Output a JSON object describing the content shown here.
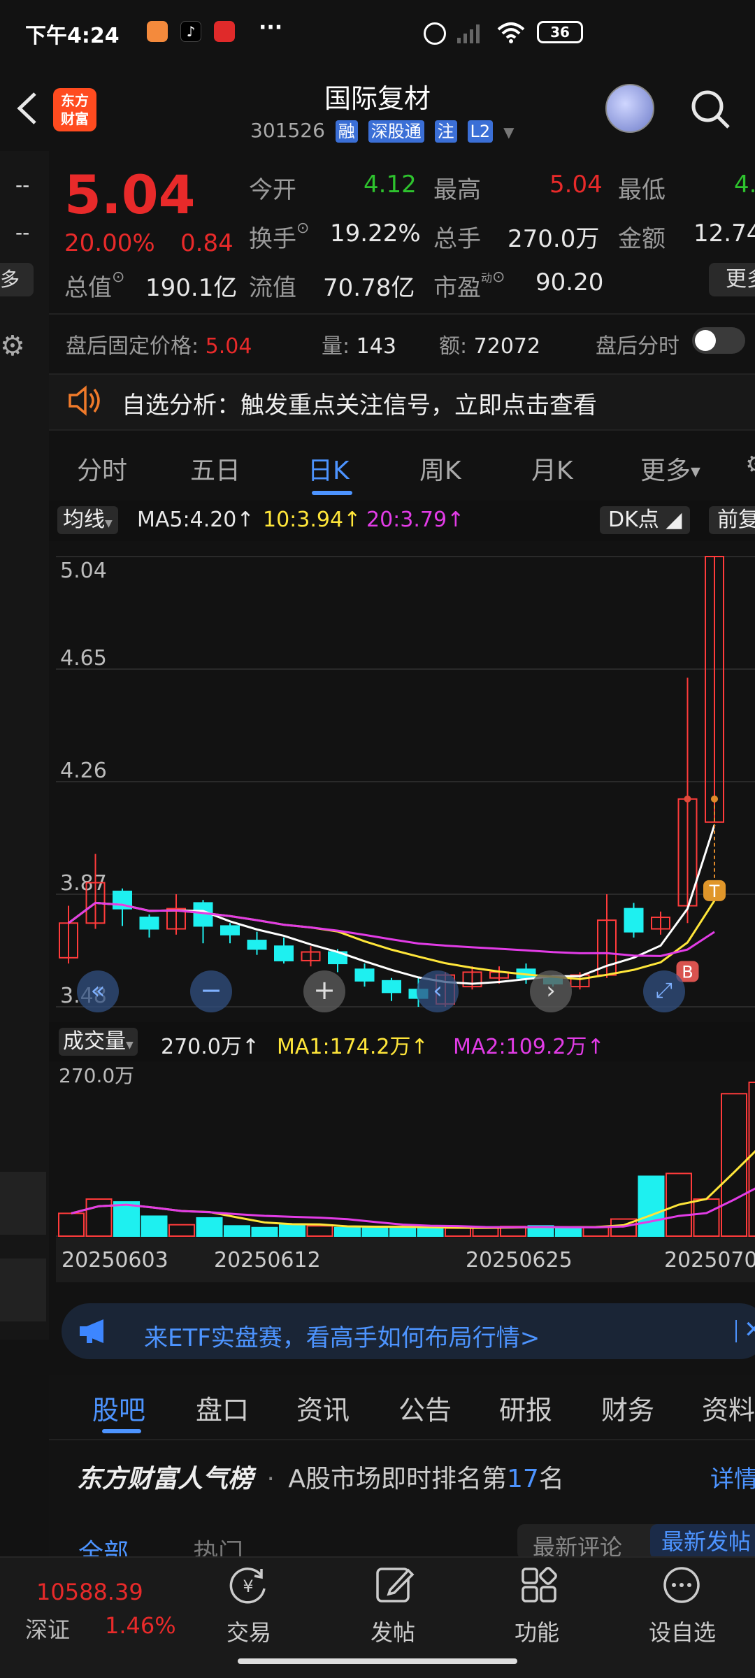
{
  "status_bar": {
    "time": "下午4:24",
    "battery": "36",
    "more": "···"
  },
  "header": {
    "logo_line1": "东方",
    "logo_line2": "财富",
    "title": "国际复材",
    "code": "301526",
    "tags": [
      "融",
      "深股通",
      "注",
      "L2"
    ]
  },
  "quote": {
    "left_col": [
      "--",
      "--",
      "多"
    ],
    "price": "5.04",
    "change_pct": "20.00%",
    "change": "0.84",
    "open_label": "今开",
    "open": "4.12",
    "high_label": "最高",
    "high": "5.04",
    "low_label": "最低",
    "low": "4.",
    "turnover_label": "换手",
    "turnover": "19.22%",
    "volume_label": "总手",
    "volume": "270.0万",
    "amount_label": "金额",
    "amount": "12.74",
    "mcap_label": "总值",
    "mcap": "190.1亿",
    "float_label": "流值",
    "float": "70.78亿",
    "pe_label": "市盈",
    "pe_sup": "动",
    "pe": "90.20",
    "more_label": "更多"
  },
  "after_hours": {
    "label": "盘后固定价格:",
    "price": "5.04",
    "vol_label": "量:",
    "vol": "143",
    "amt_label": "额:",
    "amt": "72072",
    "toggle_label": "盘后分时"
  },
  "notice": {
    "text": "自选分析：触发重点关注信号，立即点击查看"
  },
  "chart_tabs": {
    "items": [
      "分时",
      "五日",
      "日K",
      "周K",
      "月K",
      "更多"
    ],
    "active": "日K"
  },
  "ma_bar": {
    "selector": "均线",
    "ma5": "MA5:4.20",
    "ma10": "10:3.94",
    "ma20": "20:3.79",
    "dk": "DK点",
    "adjust": "前复"
  },
  "vol_bar": {
    "selector": "成交量",
    "value": "270.0万",
    "ma1": "MA1:174.2万",
    "ma2": "MA2:109.2万"
  },
  "chart_data": [
    {
      "type": "candlestick",
      "title": "",
      "y_ticks": [
        "5.04",
        "4.65",
        "4.26",
        "3.87",
        "3.48"
      ],
      "ylim": [
        3.48,
        5.04
      ],
      "grid": true,
      "series": [
        {
          "name": "MA5",
          "color": "#ffffff"
        },
        {
          "name": "10",
          "color": "#ffe63a"
        },
        {
          "name": "20",
          "color": "#e23ce6"
        }
      ],
      "candles": [
        {
          "open": 3.65,
          "close": 3.77,
          "high": 3.83,
          "low": 3.63
        },
        {
          "open": 3.77,
          "close": 3.91,
          "high": 4.01,
          "low": 3.75
        },
        {
          "open": 3.88,
          "close": 3.82,
          "high": 3.89,
          "low": 3.76
        },
        {
          "open": 3.79,
          "close": 3.75,
          "high": 3.8,
          "low": 3.72
        },
        {
          "open": 3.75,
          "close": 3.82,
          "high": 3.87,
          "low": 3.73
        },
        {
          "open": 3.84,
          "close": 3.76,
          "high": 3.85,
          "low": 3.7
        },
        {
          "open": 3.76,
          "close": 3.73,
          "high": 3.77,
          "low": 3.7
        },
        {
          "open": 3.71,
          "close": 3.68,
          "high": 3.74,
          "low": 3.66
        },
        {
          "open": 3.69,
          "close": 3.64,
          "high": 3.72,
          "low": 3.63
        },
        {
          "open": 3.64,
          "close": 3.67,
          "high": 3.69,
          "low": 3.62
        },
        {
          "open": 3.67,
          "close": 3.63,
          "high": 3.68,
          "low": 3.6
        },
        {
          "open": 3.61,
          "close": 3.57,
          "high": 3.63,
          "low": 3.55
        },
        {
          "open": 3.57,
          "close": 3.53,
          "high": 3.58,
          "low": 3.5
        },
        {
          "open": 3.54,
          "close": 3.51,
          "high": 3.58,
          "low": 3.48
        },
        {
          "open": 3.49,
          "close": 3.59,
          "high": 3.6,
          "low": 3.48
        },
        {
          "open": 3.55,
          "close": 3.6,
          "high": 3.62,
          "low": 3.54
        },
        {
          "open": 3.58,
          "close": 3.6,
          "high": 3.62,
          "low": 3.56
        },
        {
          "open": 3.61,
          "close": 3.58,
          "high": 3.63,
          "low": 3.56
        },
        {
          "open": 3.58,
          "close": 3.56,
          "high": 3.59,
          "low": 3.55
        },
        {
          "open": 3.55,
          "close": 3.59,
          "high": 3.6,
          "low": 3.54
        },
        {
          "open": 3.59,
          "close": 3.78,
          "high": 3.87,
          "low": 3.58
        },
        {
          "open": 3.82,
          "close": 3.74,
          "high": 3.84,
          "low": 3.72
        },
        {
          "open": 3.75,
          "close": 3.79,
          "high": 3.81,
          "low": 3.73
        },
        {
          "open": 3.83,
          "close": 4.2,
          "high": 4.62,
          "low": 3.77
        },
        {
          "open": 4.12,
          "close": 5.04,
          "high": 5.04,
          "low": 4.12
        }
      ],
      "markers": [
        "B",
        "T"
      ]
    },
    {
      "type": "bar",
      "title": "",
      "y_ticks": [
        "270.0万"
      ],
      "ylim": [
        0,
        270.0
      ],
      "x_ticks": [
        "20250603",
        "20250612",
        "20250625",
        "2025070"
      ],
      "values": [
        40,
        65,
        60,
        35,
        20,
        32,
        18,
        15,
        20,
        18,
        15,
        15,
        14,
        16,
        14,
        14,
        17,
        18,
        15,
        16,
        30,
        105,
        110,
        65,
        250,
        270
      ],
      "series": [
        {
          "name": "MA1",
          "color": "#ffe63a"
        },
        {
          "name": "MA2",
          "color": "#e23ce6"
        }
      ]
    }
  ],
  "etf_banner": {
    "text": "来ETF实盘赛，看高手如何布局行情>"
  },
  "bottom_tabs": {
    "items": [
      "股吧",
      "盘口",
      "资讯",
      "公告",
      "研报",
      "财务",
      "资料"
    ],
    "active": "股吧"
  },
  "popularity": {
    "brand": "东方财富人气榜",
    "dot": "·",
    "pre": "A股市场即时排名第",
    "rank": "17",
    "post": "名",
    "detail": "详情"
  },
  "filter_tabs": {
    "all": "全部",
    "hot": "热门",
    "latest_comment": "最新评论",
    "latest_post": "最新发帖"
  },
  "nav": {
    "index_value": "10588.39",
    "index_name": "深证",
    "index_pct": "1.46%",
    "items": [
      "交易",
      "发帖",
      "功能",
      "设自选"
    ]
  }
}
